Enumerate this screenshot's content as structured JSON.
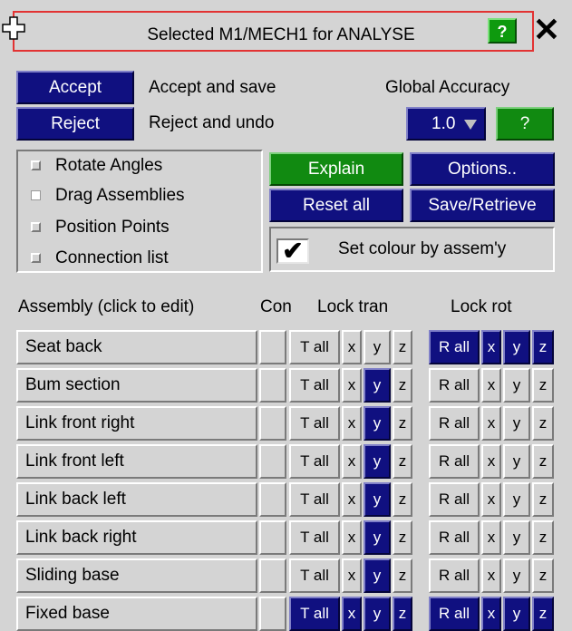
{
  "title_bar": {
    "title": "Selected M1/MECH1 for ANALYSE",
    "help_label": "?",
    "close_label": "✕"
  },
  "actions": {
    "accept_label": "Accept",
    "accept_desc": "Accept and save",
    "reject_label": "Reject",
    "reject_desc": "Reject and undo",
    "global_accuracy_label": "Global Accuracy",
    "global_accuracy_value": "1.0",
    "accuracy_help_label": "?"
  },
  "options": [
    {
      "label": "Rotate Angles",
      "style": "gray"
    },
    {
      "label": "Drag Assemblies",
      "style": "white"
    },
    {
      "label": "Position Points",
      "style": "gray"
    },
    {
      "label": "Connection list",
      "style": "gray"
    }
  ],
  "buttons": {
    "explain": "Explain",
    "options": "Options..",
    "reset_all": "Reset all",
    "save_retrieve": "Save/Retrieve",
    "set_colour": "Set colour by assem'y",
    "set_colour_checked": "✔"
  },
  "table": {
    "headers": {
      "assembly": "Assembly (click to edit)",
      "con": "Con",
      "lock_tran": "Lock tran",
      "lock_rot": "Lock rot"
    },
    "tran_all": "T all",
    "rot_all": "R all",
    "axis_x": "x",
    "axis_y": "y",
    "axis_z": "z",
    "rows": [
      {
        "name": "Seat back",
        "t": [
          0,
          0,
          0,
          0
        ],
        "r": [
          1,
          1,
          1,
          1
        ]
      },
      {
        "name": "Bum section",
        "t": [
          0,
          0,
          1,
          0
        ],
        "r": [
          0,
          0,
          0,
          0
        ]
      },
      {
        "name": "Link front right",
        "t": [
          0,
          0,
          1,
          0
        ],
        "r": [
          0,
          0,
          0,
          0
        ]
      },
      {
        "name": "Link front left",
        "t": [
          0,
          0,
          1,
          0
        ],
        "r": [
          0,
          0,
          0,
          0
        ]
      },
      {
        "name": "Link back left",
        "t": [
          0,
          0,
          1,
          0
        ],
        "r": [
          0,
          0,
          0,
          0
        ]
      },
      {
        "name": "Link back right",
        "t": [
          0,
          0,
          1,
          0
        ],
        "r": [
          0,
          0,
          0,
          0
        ]
      },
      {
        "name": "Sliding base",
        "t": [
          0,
          0,
          1,
          0
        ],
        "r": [
          0,
          0,
          0,
          0
        ]
      },
      {
        "name": "Fixed base",
        "t": [
          1,
          1,
          1,
          1
        ],
        "r": [
          1,
          1,
          1,
          1
        ]
      }
    ]
  }
}
